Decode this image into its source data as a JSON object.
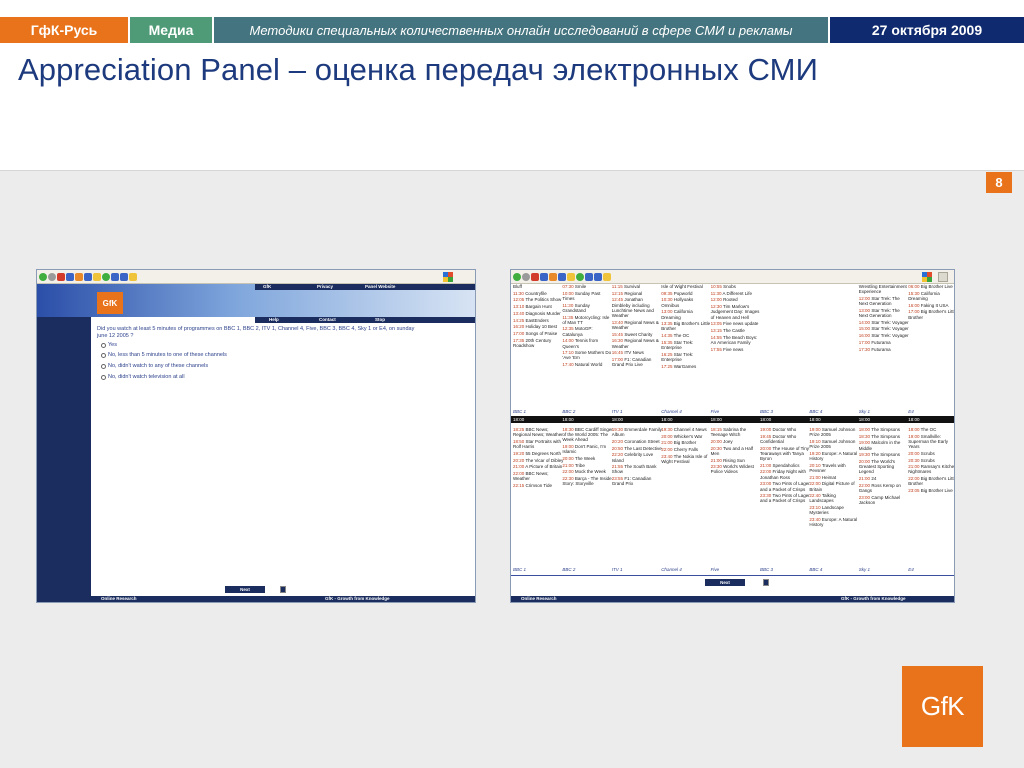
{
  "header": {
    "brand": "ГфК-Русь",
    "section": "Медиа",
    "subtitle": "Методики специальных количественных онлайн исследований в сфере СМИ и рекламы",
    "date": "27 октября 2009"
  },
  "slide": {
    "title": "Appreciation Panel – оценка передач электронных СМИ",
    "page_number": "8"
  },
  "survey": {
    "logo": "GfK",
    "nav_top": [
      "GfK",
      "Privacy",
      "Panel Website"
    ],
    "nav_bottom": [
      "Help",
      "Contact",
      "Stop"
    ],
    "question": "Did you watch at least 5 minutes of programmes on BBC 1, BBC 2, ITV 1, Channel 4, Five, BBC 3, BBC 4, Sky 1 or E4, on sunday june 12 2005 ?",
    "options": [
      "Yes",
      "No, less than 5 minutes to one of these channels",
      "No, didn't watch to any of these channels",
      "No, didn't watch television at all"
    ],
    "next_label": "Next",
    "footer_left": "Online Research",
    "footer_right": "GfK - Growth from Knowledge"
  },
  "tvgrid": {
    "channels": [
      "BBC 1",
      "BBC 2",
      "ITV 1",
      "Channel 4",
      "Five",
      "BBC 3",
      "BBC 4",
      "Sky 1",
      "E4"
    ],
    "time_label": "18:00",
    "next_label": "Next",
    "footer_left": "Online Research",
    "footer_right": "GfK - Growth from Knowledge",
    "top_columns": [
      [
        [
          "",
          "Bluff"
        ],
        [
          "11:30",
          "Countryfile"
        ],
        [
          "12:05",
          "The Politics Show"
        ],
        [
          "13:10",
          "Bargain Hunt"
        ],
        [
          "13:40",
          "Diagnosis Murder"
        ],
        [
          "14:25",
          "EastEnders"
        ],
        [
          "16:20",
          "Holiday 10 Best"
        ],
        [
          "17:00",
          "Songs of Praise"
        ],
        [
          "17:35",
          "20th Century Roadshow"
        ]
      ],
      [
        [
          "07:30",
          "Smile"
        ],
        [
          "10:00",
          "Sunday Past Times"
        ],
        [
          "11:30",
          "Sunday Grandstand"
        ],
        [
          "11:35",
          "Motorcycling: Isle of Man TT"
        ],
        [
          "12:35",
          "MotoGP: Catalunya"
        ],
        [
          "14:00",
          "Tennis from Queen's"
        ],
        [
          "17:10",
          "Some Mothers Do 'Ave 'Em"
        ],
        [
          "17:40",
          "Natural World"
        ]
      ],
      [
        [
          "11:15",
          "Survival"
        ],
        [
          "12:15",
          "Regional"
        ],
        [
          "12:45",
          "Jonathan Dimbleby including Lunchtime News and Weather"
        ],
        [
          "13:40",
          "Regional News & Weather"
        ],
        [
          "15:45",
          "Sweet Charity"
        ],
        [
          "16:30",
          "Regional News & Weather"
        ],
        [
          "16:45",
          "ITV News"
        ],
        [
          "17:00",
          "F1: Canadian Grand Prix Live"
        ]
      ],
      [
        [
          "",
          "Isle of Wight Festival"
        ],
        [
          "09:35",
          "Popworld"
        ],
        [
          "10:30",
          "Hollyoaks Omnibus"
        ],
        [
          "13:00",
          "California Dreaming"
        ],
        [
          "13:35",
          "Big Brother's Little Brother"
        ],
        [
          "14:35",
          "The OC"
        ],
        [
          "15:35",
          "Star Trek: Enterprise"
        ],
        [
          "16:25",
          "Star Trek: Enterprise"
        ],
        [
          "17:25",
          "WarGames"
        ]
      ],
      [
        [
          "10:55",
          "Snobs"
        ],
        [
          "11:30",
          "A Different Life"
        ],
        [
          "12:00",
          "Rooted"
        ],
        [
          "12:30",
          "Tim Marlow's Judgement Day: Images of Heaven and Hell"
        ],
        [
          "13:05",
          "Five news update"
        ],
        [
          "13:15",
          "The Castle"
        ],
        [
          "14:55",
          "The Beach Boys: An American Family"
        ],
        [
          "17:55",
          "Five news"
        ]
      ],
      [],
      [],
      [
        [
          "",
          "Wrestling Entertainment Experience"
        ],
        [
          "12:00",
          "Star Trek: The Next Generation"
        ],
        [
          "13:00",
          "Star Trek: The Next Generation"
        ],
        [
          "14:00",
          "Star Trek: Voyager"
        ],
        [
          "15:00",
          "Star Trek: Voyager"
        ],
        [
          "16:00",
          "Star Trek: Voyager"
        ],
        [
          "17:00",
          "Futurama"
        ],
        [
          "17:30",
          "Futurama"
        ]
      ],
      [
        [
          "06:00",
          "Big Brother Live"
        ],
        [
          "15:30",
          "California Dreaming"
        ],
        [
          "16:00",
          "Faking It USA"
        ],
        [
          "17:00",
          "Big Brother's Little Brother"
        ]
      ]
    ],
    "bottom_columns": [
      [
        [
          "18:25",
          "BBC News; Regional News; Weather"
        ],
        [
          "18:50",
          "Star Portraits with Rolf Harris"
        ],
        [
          "19:20",
          "55 Degrees North"
        ],
        [
          "20:20",
          "The Vicar of Dibley"
        ],
        [
          "21:00",
          "A Picture of Britain"
        ],
        [
          "22:00",
          "BBC News; Weather"
        ],
        [
          "22:15",
          "Crimson Tide"
        ]
      ],
      [
        [
          "18:30",
          "BBC Cardiff Singer of the World 2005: The Week Ahead"
        ],
        [
          "19:00",
          "Don't Panic, I'm Islamic"
        ],
        [
          "20:00",
          "The Week"
        ],
        [
          "21:00",
          "Tribe"
        ],
        [
          "22:00",
          "Mock the Week"
        ],
        [
          "22:30",
          "Barça - The Inside Story: Storyville"
        ]
      ],
      [
        [
          "19:30",
          "Emmerdale Family Album"
        ],
        [
          "20:20",
          "Coronation Street"
        ],
        [
          "20:50",
          "The Last Detective"
        ],
        [
          "22:20",
          "Celebrity Love Island"
        ],
        [
          "21:55",
          "The South Bank Show"
        ],
        [
          "23:55",
          "F1: Canadian Grand Prix"
        ]
      ],
      [
        [
          "19:30",
          "Channel 4 News"
        ],
        [
          "20:00",
          "Whicker's War"
        ],
        [
          "21:00",
          "Big Brother"
        ],
        [
          "22:00",
          "Cherry Falls"
        ],
        [
          "23:40",
          "The Nokia Isle of Wight Festival"
        ]
      ],
      [
        [
          "18:15",
          "Sabrina the Teenage Witch"
        ],
        [
          "20:00",
          "Joey"
        ],
        [
          "20:30",
          "Two and a Half Men"
        ],
        [
          "21:00",
          "Rising Sun"
        ],
        [
          "23:30",
          "World's Wildest Police Videos"
        ]
      ],
      [
        [
          "19:00",
          "Doctor Who"
        ],
        [
          "19:45",
          "Doctor Who Confidential"
        ],
        [
          "20:00",
          "The House of Tiny Tearaways with Tanya Byron"
        ],
        [
          "21:00",
          "Spendaholics"
        ],
        [
          "22:00",
          "Friday Night with Jonathan Ross"
        ],
        [
          "23:00",
          "Two Pints of Lager and a Packet of Crisps"
        ],
        [
          "23:30",
          "Two Pints of Lager and a Packet of Crisps"
        ]
      ],
      [
        [
          "19:00",
          "Samuel Johnson Prize 2005"
        ],
        [
          "19:10",
          "Samuel Johnson Prize 2005"
        ],
        [
          "19:20",
          "Europe: A Natural History"
        ],
        [
          "20:10",
          "Travels with Pevsner"
        ],
        [
          "21:00",
          "Heimat"
        ],
        [
          "22:00",
          "Digital Picture of Britain"
        ],
        [
          "22:40",
          "Talking Landscapes"
        ],
        [
          "23:10",
          "Landscape Mysteries"
        ],
        [
          "23:40",
          "Europe: A Natural History"
        ]
      ],
      [
        [
          "18:00",
          "The Simpsons"
        ],
        [
          "18:30",
          "The Simpsons"
        ],
        [
          "19:00",
          "Malcolm in the Middle"
        ],
        [
          "19:30",
          "The Simpsons"
        ],
        [
          "20:00",
          "The World's Greatest Sporting Legend"
        ],
        [
          "21:00",
          "24"
        ],
        [
          "22:00",
          "Ross Kemp on Gangs"
        ],
        [
          "23:00",
          "Camp Michael Jackson"
        ]
      ],
      [
        [
          "18:00",
          "The OC"
        ],
        [
          "19:00",
          "Smallville: Superman the Early Years"
        ],
        [
          "20:00",
          "Scrubs"
        ],
        [
          "20:30",
          "Scrubs"
        ],
        [
          "21:00",
          "Ramsay's Kitchen Nightmares"
        ],
        [
          "22:00",
          "Big Brother's Little Brother"
        ],
        [
          "23:05",
          "Big Brother Live"
        ]
      ]
    ]
  },
  "logo": {
    "text": "GfK"
  },
  "colors": {
    "orange": "#e8731b",
    "green": "#4f9b77",
    "teal": "#44747f",
    "navy": "#0f2a6e",
    "title_blue": "#1c3a7d"
  }
}
